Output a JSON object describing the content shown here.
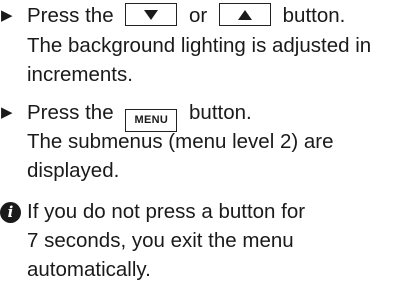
{
  "step1": {
    "arrow": "▶",
    "press": "Press the",
    "key_down_icon": "down-triangle",
    "or": "or",
    "key_up_icon": "up-triangle",
    "button": "button.",
    "result_line1": "The background lighting is adjusted in",
    "result_line2": "increments."
  },
  "step2": {
    "arrow": "▶",
    "press": "Press the",
    "key_label": "MENU",
    "button": "button.",
    "result_line1": "The submenus (menu level 2) are",
    "result_line2": "displayed."
  },
  "note": {
    "icon_glyph": "i",
    "line1": "If you do not press a button for",
    "line2": "7 seconds, you exit the menu",
    "line3": "automatically."
  }
}
